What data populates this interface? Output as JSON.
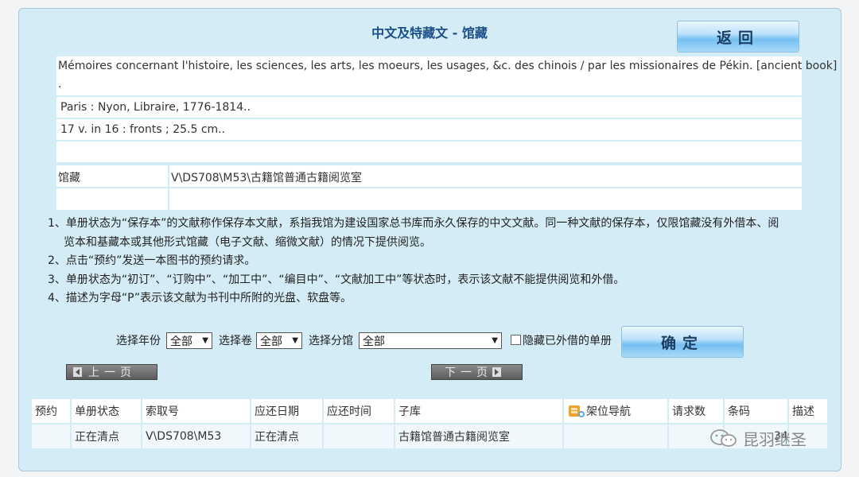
{
  "header": {
    "title": "中文及特藏文 - 馆藏",
    "back_label": "返回"
  },
  "record": {
    "title": "Mémoires concernant l'histoire, les sciences, les arts, les moeurs, les usages, &c. des chinois / par les missionaires de Pékin. [ancient book]",
    "title_cont": ".",
    "publication": "Paris : Nyon, Libraire, 1776-1814..",
    "physical": "17 v. in 16 : fronts ; 25.5 cm..",
    "holdings_label": "馆藏",
    "holdings_value": "V\\DS708\\M53\\古籍馆普通古籍阅览室"
  },
  "notes": [
    "1、单册状态为“保存本”的文献称作保存本文献，系指我馆为建设国家总书库而永久保存的中文文献。同一种文献的保存本，仅限馆藏没有外借本、阅",
    "览本和基藏本或其他形式馆藏（电子文献、缩微文献）的情况下提供阅览。",
    "2、点击“预约”发送一本图书的预约请求。",
    "3、单册状态为“初订”、“订购中”、“加工中”、“编目中”、“文献加工中”等状态时，表示该文献不能提供阅览和外借。",
    "4、描述为字母“P”表示该文献为书刊中所附的光盘、软盘等。"
  ],
  "filters": {
    "year_label": "选择年份",
    "year_value": "全部",
    "volume_label": "选择卷",
    "volume_value": "全部",
    "branch_label": "选择分馆",
    "branch_value": "全部",
    "hide_label": "隐藏已外借的单册",
    "ok_label": "确定"
  },
  "pager": {
    "prev": "上一页",
    "next": "下一页"
  },
  "table": {
    "headers": [
      "预约",
      "单册状态",
      "索取号",
      "应还日期",
      "应还时间",
      "子库",
      "架位导航",
      "请求数",
      "条码",
      "描述"
    ],
    "rows": [
      [
        "",
        "正在清点",
        "V\\DS708\\M53",
        "正在清点",
        "",
        "古籍馆普通古籍阅览室",
        "",
        "",
        "",
        ""
      ]
    ]
  },
  "watermark": {
    "text": "昆羽继圣",
    "partial_barcode": "34"
  }
}
